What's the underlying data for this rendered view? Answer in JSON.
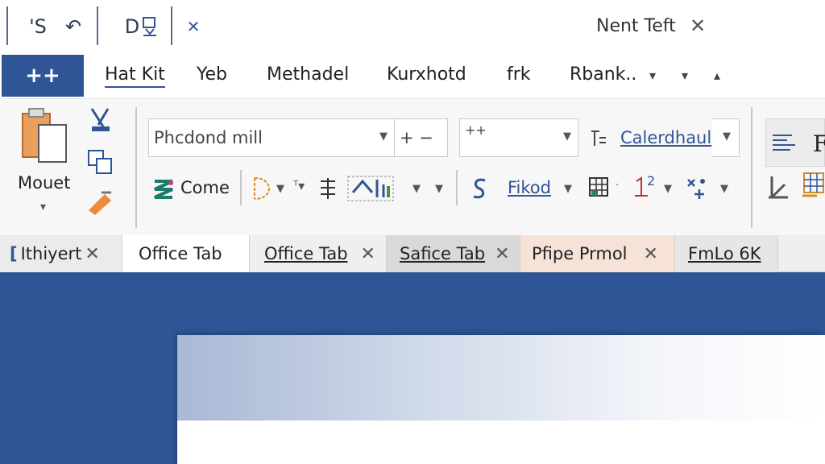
{
  "titlebar": {
    "quick_access": [
      {
        "label": "'S",
        "icon": "save-icon"
      },
      {
        "label": "↶",
        "icon": "undo-icon"
      },
      {
        "label": "D",
        "icon": "document-icon"
      },
      {
        "label": "✕",
        "icon": "close-icon"
      }
    ],
    "doc_title": "Nent Teft",
    "close": "✕"
  },
  "menubar": {
    "file_button": "++",
    "items": [
      "Hat Kit",
      "Yeb",
      "Methadel",
      "Kurxhotd",
      "frk",
      "Rbank.."
    ],
    "arrows": [
      "▾",
      "▾",
      "▴"
    ]
  },
  "ribbon": {
    "mouet_label": "Mouet",
    "font_combo": "Phcdond mill",
    "font_combo_extra": "+ −",
    "size_combo": "++",
    "calendar_link": "Calerdhaul",
    "come_label": "Come",
    "fikod_label": "Fikod",
    "superscript": "2"
  },
  "tabs": [
    {
      "label": "Ithiyert",
      "close": "✕"
    },
    {
      "label": "Office Tab",
      "close": ""
    },
    {
      "label": "Office Tab",
      "close": "✕"
    },
    {
      "label": "Safice Tab",
      "close": "✕"
    },
    {
      "label": "Pfipe Prmol",
      "close": "✕"
    },
    {
      "label": "FmLo 6K",
      "close": ""
    }
  ],
  "colors": {
    "accent": "#2f5597",
    "peach_tab": "#f6e2d6",
    "gray_tab": "#d9d9d9"
  }
}
